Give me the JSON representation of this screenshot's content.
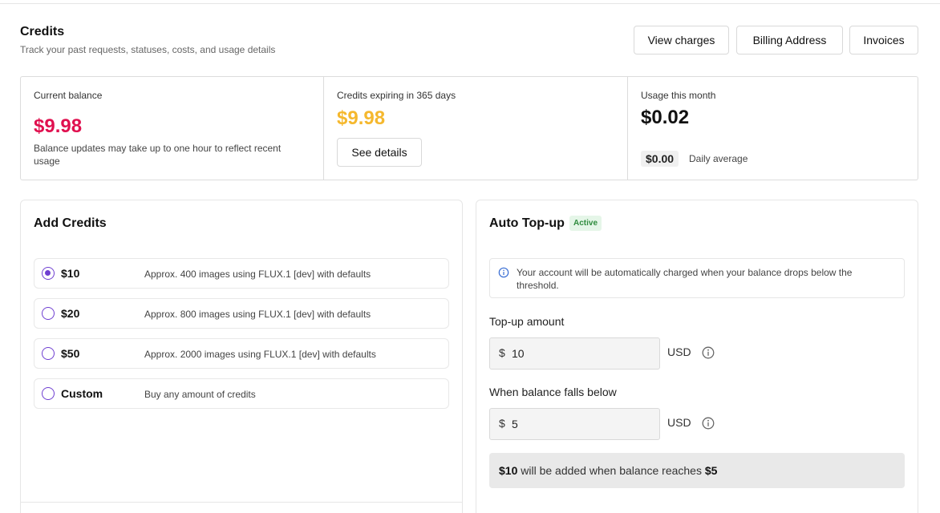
{
  "header": {
    "title": "Credits",
    "subtitle": "Track your past requests, statuses, costs, and usage details",
    "buttons": {
      "view_charges": "View charges",
      "billing_address": "Billing Address",
      "invoices": "Invoices"
    }
  },
  "stats": {
    "current_balance": {
      "label": "Current balance",
      "value": "$9.98",
      "note": "Balance updates may take up to one hour to reflect recent usage",
      "color": "#e0104f"
    },
    "expiring": {
      "label": "Credits expiring in 365 days",
      "value": "$9.98",
      "button": "See details",
      "color": "#f5b82e"
    },
    "usage": {
      "label": "Usage this month",
      "value": "$0.02",
      "daily_value": "$0.00",
      "daily_label": "Daily average"
    }
  },
  "add_credits": {
    "title": "Add Credits",
    "options": [
      {
        "label": "$10",
        "desc": "Approx. 400 images using FLUX.1 [dev] with defaults",
        "selected": true
      },
      {
        "label": "$20",
        "desc": "Approx. 800 images using FLUX.1 [dev] with defaults",
        "selected": false
      },
      {
        "label": "$50",
        "desc": "Approx. 2000 images using FLUX.1 [dev] with defaults",
        "selected": false
      },
      {
        "label": "Custom",
        "desc": "Buy any amount of credits",
        "selected": false
      }
    ]
  },
  "auto_topup": {
    "title": "Auto Top-up",
    "status": "Active",
    "info": "Your account will be automatically charged when your balance drops below the threshold.",
    "topup_label": "Top-up amount",
    "topup_currency": "$",
    "topup_value": "10",
    "topup_unit": "USD",
    "threshold_label": "When balance falls below",
    "threshold_currency": "$",
    "threshold_value": "5",
    "threshold_unit": "USD",
    "summary": {
      "amount": "$10",
      "middle": " will be added when balance reaches ",
      "threshold": "$5"
    }
  },
  "colors": {
    "accent": "#6f3fd1",
    "active_badge_bg": "#e5f6e8",
    "active_badge_text": "#2e8b3d",
    "info_icon": "#3b6fd4"
  },
  "icons": {
    "info": "info-icon",
    "radio": "radio-button"
  }
}
